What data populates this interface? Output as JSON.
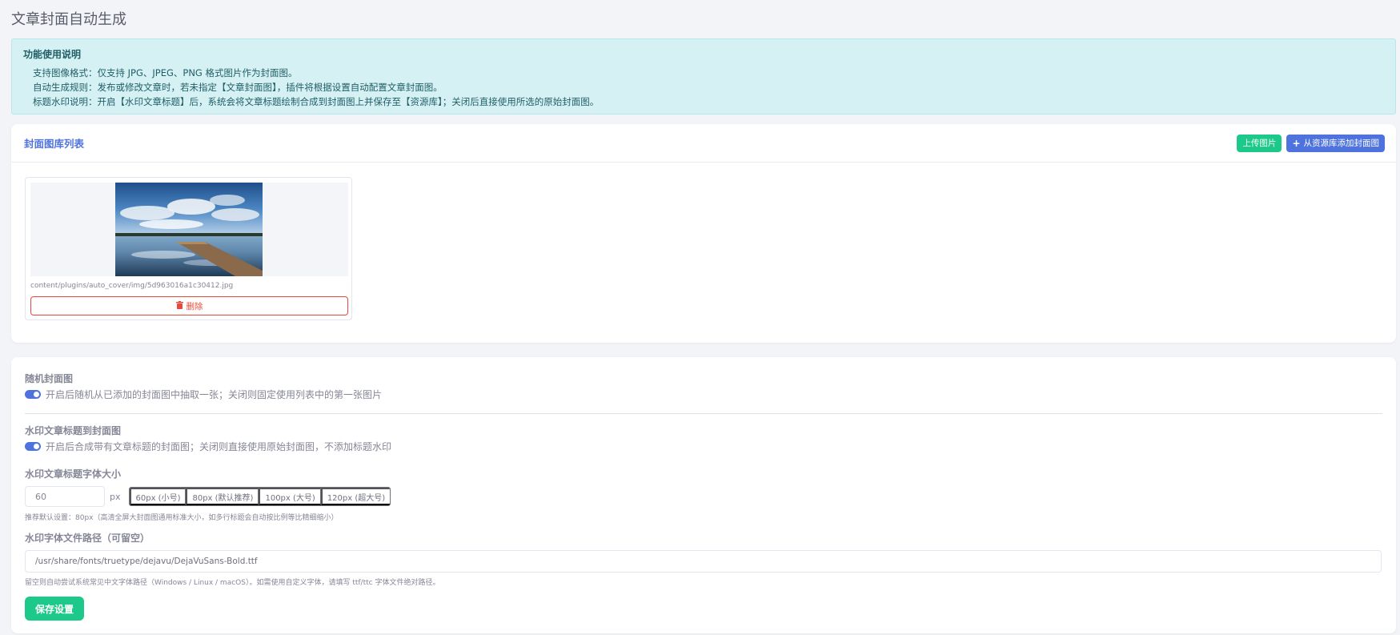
{
  "page": {
    "title": "文章封面自动生成"
  },
  "notice": {
    "title": "功能使用说明",
    "lines": [
      "支持图像格式：仅支持 JPG、JPEG、PNG 格式图片作为封面图。",
      "自动生成规则：发布或修改文章时，若未指定【文章封面图】，插件将根据设置自动配置文章封面图。",
      "标题水印说明：开启【水印文章标题】后，系统会将文章标题绘制合成到封面图上并保存至【资源库】；关闭后直接使用所选的原始封面图。"
    ]
  },
  "gallery": {
    "title": "封面图库列表",
    "upload_label": "上传图片",
    "add_from_library_label": "从资源库添加封面图",
    "items": [
      {
        "path": "content/plugins/auto_cover/img/5d963016a1c30412.jpg",
        "delete_label": "删除"
      }
    ]
  },
  "settings": {
    "random": {
      "label": "随机封面图",
      "enabled": true,
      "desc": "开启后随机从已添加的封面图中抽取一张；关闭则固定使用列表中的第一张图片"
    },
    "watermark": {
      "label": "水印文章标题到封面图",
      "enabled": true,
      "desc": "开启后合成带有文章标题的封面图；关闭则直接使用原始封面图，不添加标题水印"
    },
    "font_size": {
      "label": "水印文章标题字体大小",
      "value": "60",
      "unit": "px",
      "presets": [
        "60px (小号)",
        "80px (默认推荐)",
        "100px (大号)",
        "120px (超大号)"
      ],
      "hint": "推荐默认设置：80px（高清全屏大封面图通用标准大小，如多行标题会自动按比例等比精细缩小）"
    },
    "font_path": {
      "label": "水印字体文件路径（可留空）",
      "value": "/usr/share/fonts/truetype/dejavu/DejaVuSans-Bold.ttf",
      "hint": "留空则自动尝试系统常见中文字体路径（Windows / Linux / macOS）。如需使用自定义字体，请填写 ttf/ttc 字体文件绝对路径。"
    },
    "save_label": "保存设置"
  },
  "colors": {
    "primary": "#4e73df",
    "success": "#1cc88a",
    "danger": "#e74a3b",
    "info_bg": "#d6f1f4"
  }
}
